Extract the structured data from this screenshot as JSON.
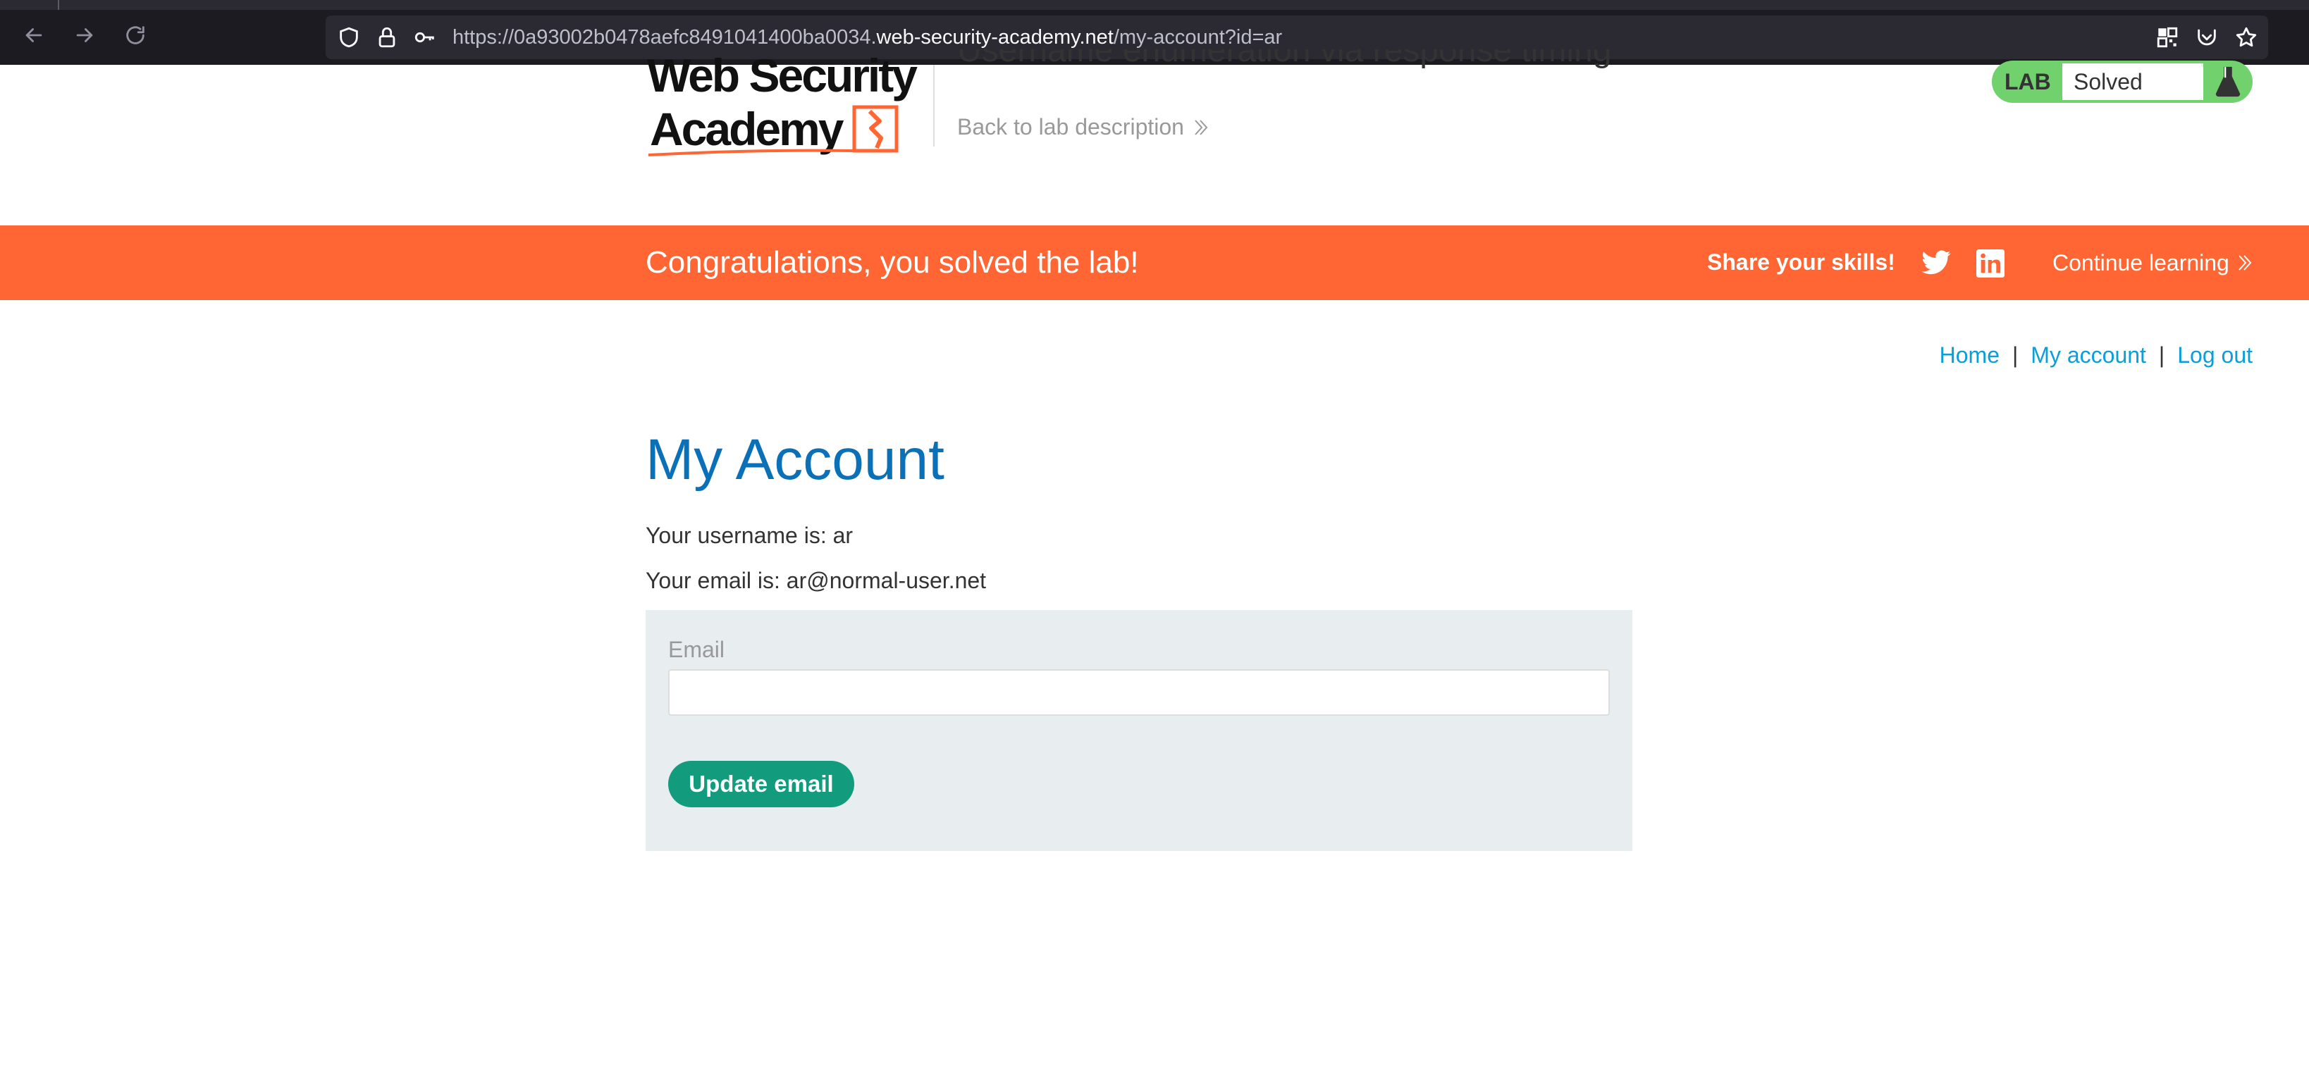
{
  "browser": {
    "url_prefix": "https://0a93002b0478aefc8491041400ba0034.",
    "url_host": "web-security-academy.net",
    "url_path": "/my-account?id=ar"
  },
  "header": {
    "lab_title": "Username enumeration via response timing",
    "back_link": "Back to lab description",
    "lab_badge_label": "LAB",
    "lab_status": "Solved"
  },
  "banner": {
    "message": "Congratulations, you solved the lab!",
    "share": "Share your skills!",
    "continue": "Continue learning"
  },
  "nav": {
    "home": "Home",
    "separator": "|",
    "my_account": "My account",
    "log_out": "Log out"
  },
  "content": {
    "title": "My Account",
    "username_line": "Your username is: ar",
    "email_line": "Your email is: ar@normal-user.net",
    "email_label": "Email",
    "email_value": "",
    "update_button": "Update email"
  },
  "colors": {
    "accent_orange": "#ff6633",
    "lab_green": "#70d16d",
    "link_blue": "#0b9ed8",
    "title_blue": "#0a70b8",
    "button_green": "#139b7d"
  }
}
